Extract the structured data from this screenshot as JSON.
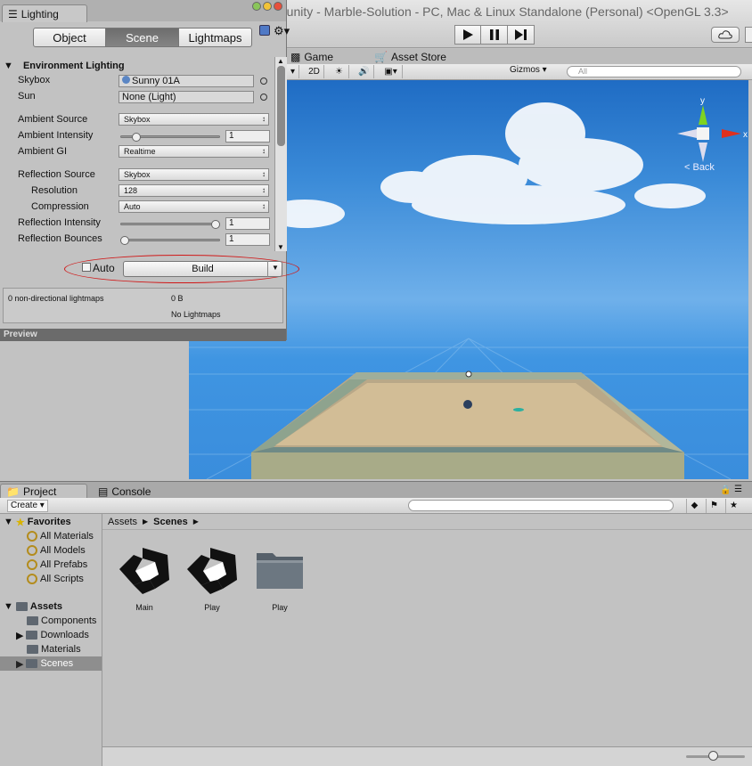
{
  "window": {
    "title": "...unity - Marble-Solution - PC, Mac & Linux Standalone (Personal) <OpenGL 3.3>"
  },
  "toolbar": {
    "play_icon": "play-icon",
    "pause_icon": "pause-icon",
    "step_icon": "step-icon",
    "cloud_icon": "cloud-icon"
  },
  "scene_tabs": {
    "game": "Game",
    "asset_store": "Asset Store"
  },
  "scene_toolbar": {
    "mode_2d": "2D",
    "gizmos": "Gizmos",
    "search_placeholder": "All"
  },
  "viewport": {
    "axis_y": "y",
    "axis_x": "x",
    "back_label": "< Back"
  },
  "lighting": {
    "tab_label": "Lighting",
    "segments": [
      "Object",
      "Scene",
      "Lightmaps"
    ],
    "active_segment": "Scene",
    "section_title": "Environment Lighting",
    "rows": {
      "skybox_label": "Skybox",
      "skybox_value": "Sunny 01A",
      "sun_label": "Sun",
      "sun_value": "None (Light)",
      "ambient_source_label": "Ambient Source",
      "ambient_source_value": "Skybox",
      "ambient_intensity_label": "Ambient Intensity",
      "ambient_intensity_value": "1",
      "ambient_gi_label": "Ambient GI",
      "ambient_gi_value": "Realtime",
      "reflection_source_label": "Reflection Source",
      "reflection_source_value": "Skybox",
      "resolution_label": "Resolution",
      "resolution_value": "128",
      "compression_label": "Compression",
      "compression_value": "Auto",
      "reflection_intensity_label": "Reflection Intensity",
      "reflection_intensity_value": "1",
      "reflection_bounces_label": "Reflection Bounces",
      "reflection_bounces_value": "1"
    },
    "sliders": {
      "ambient_intensity": 0.125,
      "reflection_intensity": 1.0,
      "reflection_bounces": 0.0
    },
    "auto_label": "Auto",
    "build_label": "Build",
    "lightmap_info": {
      "count": "0 non-directional lightmaps",
      "size": "0 B",
      "status": "No Lightmaps"
    },
    "preview_label": "Preview"
  },
  "project": {
    "tabs": {
      "project": "Project",
      "console": "Console"
    },
    "create_label": "Create",
    "tree": {
      "favorites": "Favorites",
      "favorite_items": [
        "All Materials",
        "All Models",
        "All Prefabs",
        "All Scripts"
      ],
      "assets": "Assets",
      "asset_folders": [
        "Components",
        "Downloads",
        "Materials",
        "Scenes"
      ]
    },
    "breadcrumb": [
      "Assets",
      "Scenes"
    ],
    "assets": [
      "Main",
      "Play",
      "Play"
    ]
  },
  "colors": {
    "annotation": "#d01818",
    "sky": "#3b8bd8",
    "gizmo_y": "#7ed321",
    "gizmo_x": "#e0301e"
  }
}
